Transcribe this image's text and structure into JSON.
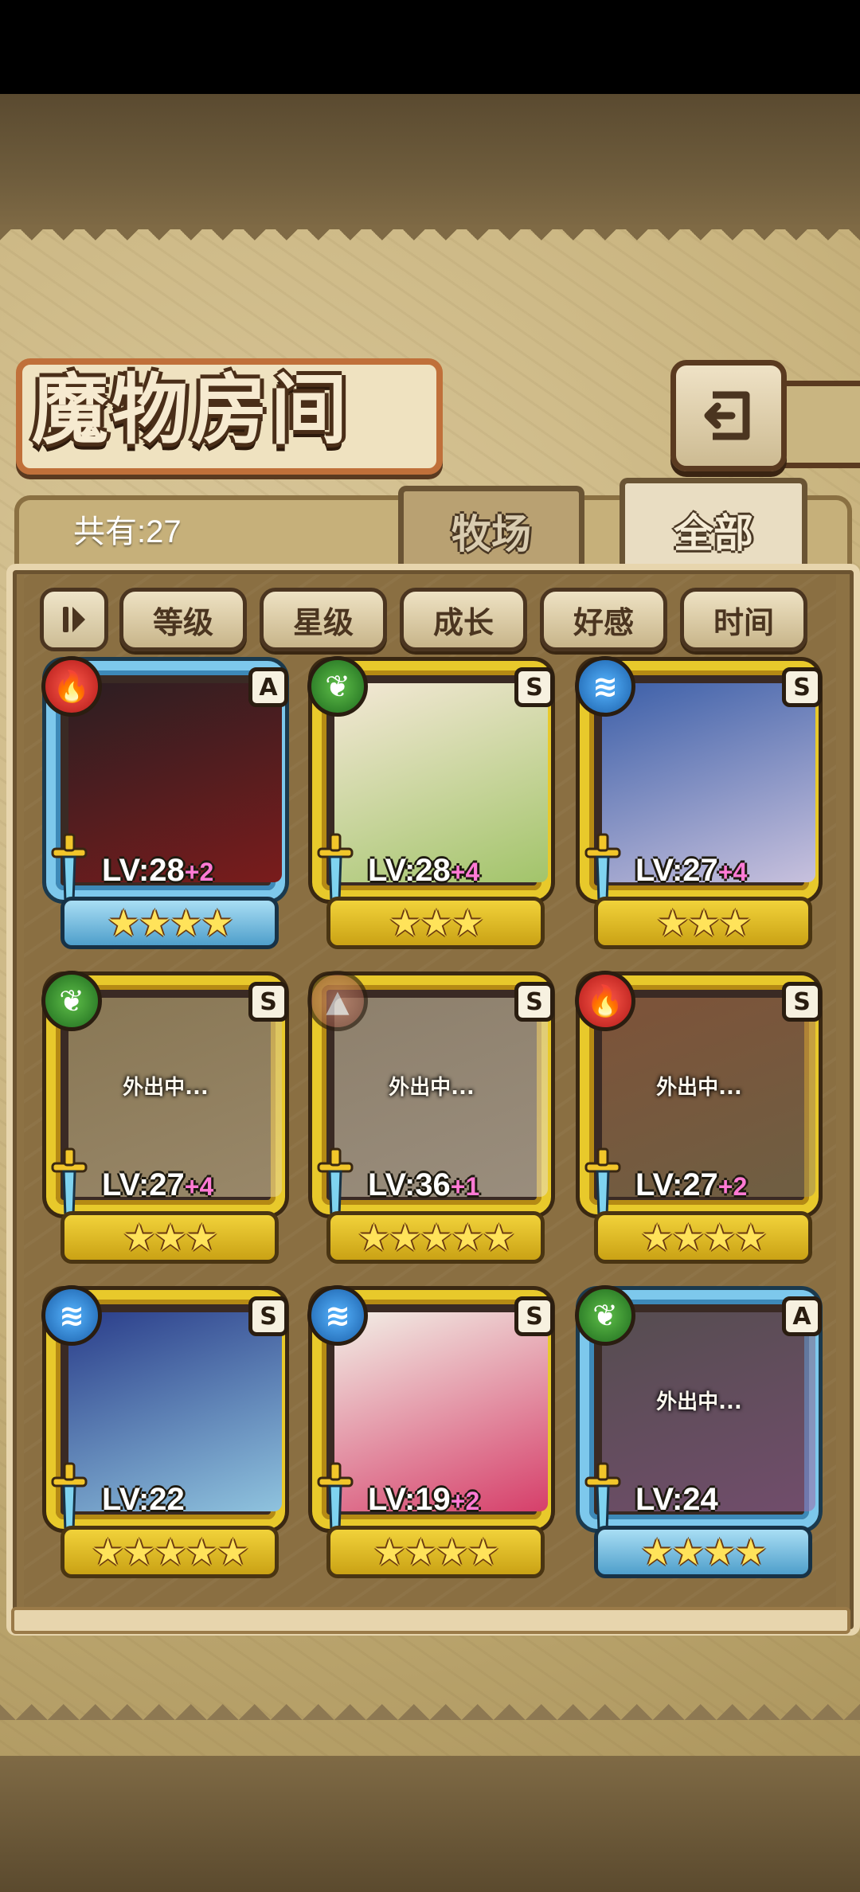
{
  "screen": {
    "title": "魔物房间",
    "count_text": "共有:27",
    "tabs": [
      "牧场",
      "全部"
    ],
    "active_tab": "全部",
    "sort_options": [
      "等级",
      "星级",
      "成长",
      "好感",
      "时间"
    ]
  },
  "monsters": [
    {
      "element": "fire",
      "element_icon": "flame-icon",
      "rank": "A",
      "frame": "blue",
      "level": "LV:28",
      "bonus": "+2",
      "stars": "★★★★",
      "away": "",
      "palette": [
        "#2b1e22",
        "#7a1c1c"
      ]
    },
    {
      "element": "leaf",
      "element_icon": "leaf-icon",
      "rank": "S",
      "frame": "gold",
      "level": "LV:28",
      "bonus": "+4",
      "stars": "★★★",
      "away": "",
      "palette": [
        "#f4e8d6",
        "#a2c46a"
      ]
    },
    {
      "element": "water",
      "element_icon": "water-icon",
      "rank": "S",
      "frame": "gold",
      "level": "LV:27",
      "bonus": "+4",
      "stars": "★★★",
      "away": "",
      "palette": [
        "#3c5fa8",
        "#c8c1dd"
      ]
    },
    {
      "element": "leaf",
      "element_icon": "leaf-icon",
      "rank": "S",
      "frame": "gold",
      "level": "LV:27",
      "bonus": "+4",
      "stars": "★★★",
      "away": "外出中...",
      "palette": [
        "#c9b67c",
        "#e6d4a2"
      ]
    },
    {
      "element": "earth",
      "element_icon": "mountain-icon",
      "rank": "S",
      "frame": "gold",
      "level": "LV:36",
      "bonus": "+1",
      "stars": "★★★★★",
      "away": "外出中...",
      "palette": [
        "#d2c6a6",
        "#e8dfc6"
      ]
    },
    {
      "element": "fire",
      "element_icon": "flame-icon",
      "rank": "S",
      "frame": "gold",
      "level": "LV:27",
      "bonus": "+2",
      "stars": "★★★★",
      "away": "外出中...",
      "palette": [
        "#b4744a",
        "#9a8a5c"
      ]
    },
    {
      "element": "water",
      "element_icon": "water-icon",
      "rank": "S",
      "frame": "gold",
      "level": "LV:22",
      "bonus": "",
      "stars": "★★★★★",
      "away": "",
      "palette": [
        "#2a3d8a",
        "#8fc3de"
      ]
    },
    {
      "element": "water",
      "element_icon": "water-icon",
      "rank": "S",
      "frame": "gold",
      "level": "LV:19",
      "bonus": "+2",
      "stars": "★★★★",
      "away": "",
      "palette": [
        "#f2efe6",
        "#d63f6a"
      ]
    },
    {
      "element": "leaf",
      "element_icon": "leaf-icon",
      "rank": "A",
      "frame": "blue",
      "level": "LV:24",
      "bonus": "",
      "stars": "★★★★",
      "away": "外出中...",
      "palette": [
        "#6c6a74",
        "#9e6aa6"
      ]
    }
  ]
}
